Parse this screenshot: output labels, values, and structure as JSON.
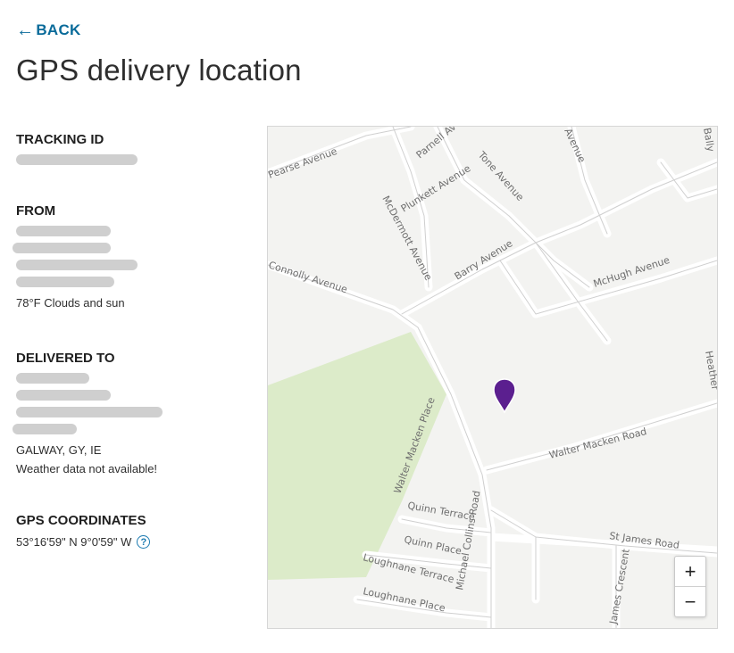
{
  "nav": {
    "back_label": "BACK"
  },
  "page": {
    "title": "GPS delivery location"
  },
  "tracking": {
    "label": "TRACKING ID"
  },
  "from": {
    "label": "FROM",
    "weather": "78°F Clouds and sun"
  },
  "delivered_to": {
    "label": "DELIVERED TO",
    "city": "GALWAY, GY, IE",
    "weather": "Weather data not available!"
  },
  "gps": {
    "label": "GPS COORDINATES",
    "value": "53°16'59\" N 9°0'59\" W",
    "help_glyph": "?"
  },
  "map": {
    "zoom_in": "+",
    "zoom_out": "−",
    "pin_color": "#5b1f8f",
    "park_color": "#dcebc9",
    "streets": [
      "Pearse Avenue",
      "Parnell Avenue",
      "Tone Avenue",
      "Avenue",
      "Plunkett Avenue",
      "McDermott Avenue",
      "Barry Avenue",
      "McHugh Avenue",
      "Connolly Avenue",
      "Walter Macken Road",
      "Walter Macken Place",
      "Quinn Terrace",
      "Quinn Place",
      "Loughnane Terrace",
      "Loughnane Place",
      "Michael Collins Road",
      "St James Road",
      "James Crescent",
      "Heather",
      "Bally"
    ]
  }
}
